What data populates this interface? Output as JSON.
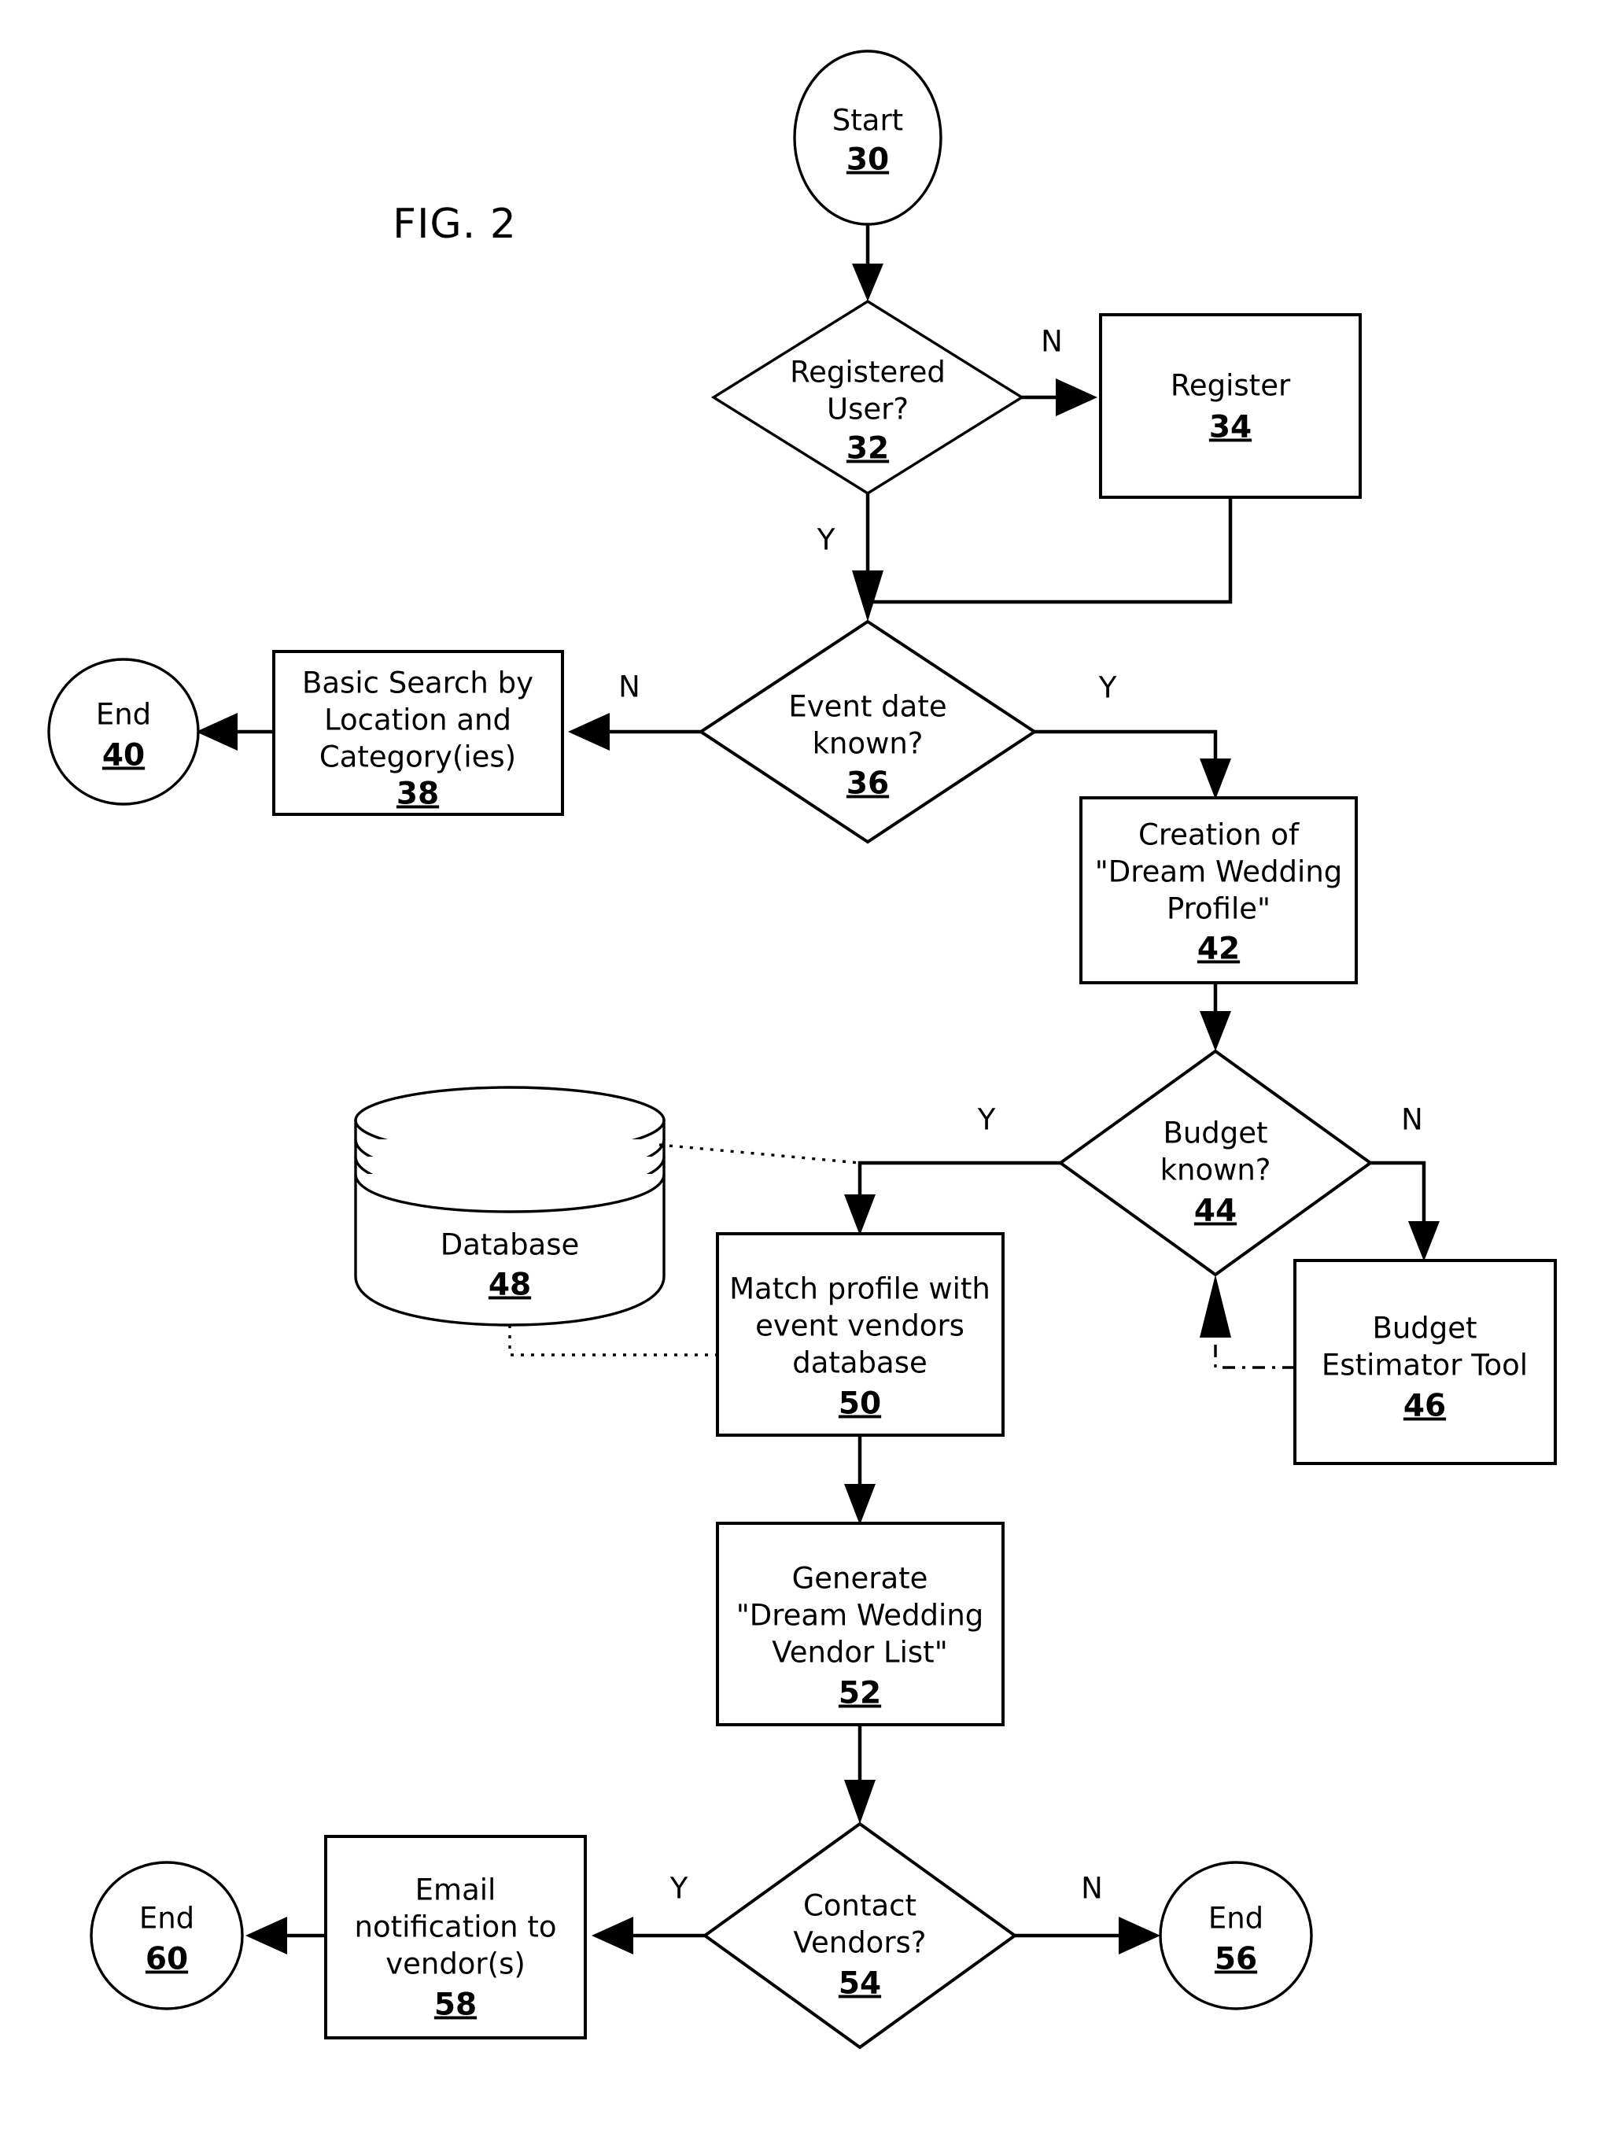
{
  "figure": {
    "title": "FIG. 2"
  },
  "nodes": {
    "start": {
      "label": "Start",
      "ref": "30",
      "shape": "terminator-ellipse"
    },
    "registered_user": {
      "label_lines": [
        "Registered",
        "User?"
      ],
      "ref": "32",
      "shape": "decision-diamond"
    },
    "register": {
      "label_lines": [
        "Register"
      ],
      "ref": "34",
      "shape": "process-box"
    },
    "event_date_known": {
      "label_lines": [
        "Event date",
        "known?"
      ],
      "ref": "36",
      "shape": "decision-diamond"
    },
    "basic_search": {
      "label_lines": [
        "Basic Search by",
        "Location and",
        "Category(ies)"
      ],
      "ref": "38",
      "shape": "process-box"
    },
    "end_40": {
      "label": "End",
      "ref": "40",
      "shape": "terminator-ellipse"
    },
    "creation_profile": {
      "label_lines": [
        "Creation of",
        "\"Dream Wedding",
        "Profile\""
      ],
      "ref": "42",
      "shape": "process-box"
    },
    "budget_known": {
      "label_lines": [
        "Budget",
        "known?"
      ],
      "ref": "44",
      "shape": "decision-diamond"
    },
    "budget_estimator": {
      "label_lines": [
        "Budget",
        "Estimator Tool"
      ],
      "ref": "46",
      "shape": "process-box"
    },
    "database": {
      "label": "Database",
      "ref": "48",
      "shape": "database-cylinder"
    },
    "match_profile": {
      "label_lines": [
        "Match profile with",
        "event vendors",
        "database"
      ],
      "ref": "50",
      "shape": "process-box"
    },
    "generate_list": {
      "label_lines": [
        "Generate",
        "\"Dream Wedding",
        "Vendor List\""
      ],
      "ref": "52",
      "shape": "process-box"
    },
    "contact_vendors": {
      "label_lines": [
        "Contact",
        "Vendors?"
      ],
      "ref": "54",
      "shape": "decision-diamond"
    },
    "end_56": {
      "label": "End",
      "ref": "56",
      "shape": "terminator-ellipse"
    },
    "email_notification": {
      "label_lines": [
        "Email",
        "notification to",
        "vendor(s)"
      ],
      "ref": "58",
      "shape": "process-box"
    },
    "end_60": {
      "label": "End",
      "ref": "60",
      "shape": "terminator-ellipse"
    }
  },
  "branch_labels": {
    "registered_user_no": "N",
    "registered_user_yes": "Y",
    "event_date_no": "N",
    "event_date_yes": "Y",
    "budget_yes": "Y",
    "budget_no": "N",
    "contact_yes": "Y",
    "contact_no": "N"
  },
  "colors": {
    "stroke": "#000000",
    "fill": "#ffffff",
    "background": "#ffffff"
  }
}
